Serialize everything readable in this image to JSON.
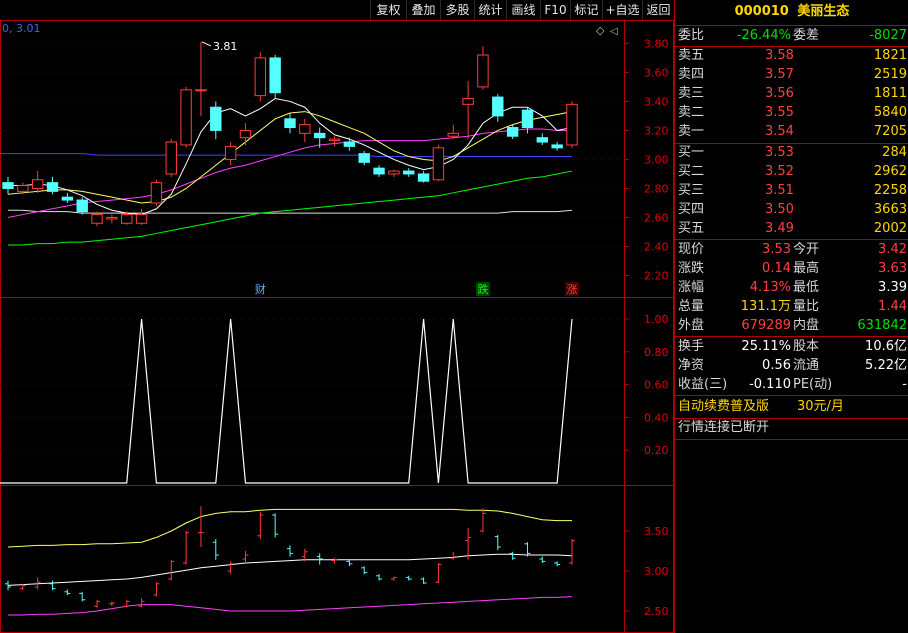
{
  "toolbar": {
    "buttons": [
      "复权",
      "叠加",
      "多股",
      "统计",
      "画线",
      "F10",
      "标记",
      "+自选",
      "返回"
    ]
  },
  "stock": {
    "code": "000010",
    "name": "美丽生态"
  },
  "chart": {
    "ma_legend": "0, 3.01",
    "high_label": "3.81",
    "price_axis": [
      "3.80",
      "3.60",
      "3.40",
      "3.20",
      "3.00",
      "2.80",
      "2.60",
      "2.40",
      "2.20"
    ],
    "markers": [
      "财",
      "跌",
      "涨"
    ],
    "ind_axis": [
      "1.00",
      "0.80",
      "0.60",
      "0.40",
      "0.20"
    ],
    "bot_axis": [
      "3.50",
      "3.00",
      "2.50"
    ],
    "colors": {
      "up": "#ff3c3c",
      "down": "#54ffff",
      "ma1": "#ffffff",
      "ma2": "#ffff66",
      "ma3": "#ff40ff",
      "ma4": "#00ff00",
      "ma5": "#4040ff",
      "frame": "#b00000"
    }
  },
  "chart_data": {
    "type": "candlestick",
    "candles": [
      {
        "o": 2.84,
        "h": 2.88,
        "l": 2.76,
        "c": 2.8
      },
      {
        "o": 2.78,
        "h": 2.84,
        "l": 2.76,
        "c": 2.82
      },
      {
        "o": 2.8,
        "h": 2.92,
        "l": 2.77,
        "c": 2.86
      },
      {
        "o": 2.84,
        "h": 2.88,
        "l": 2.76,
        "c": 2.78
      },
      {
        "o": 2.74,
        "h": 2.77,
        "l": 2.7,
        "c": 2.72
      },
      {
        "o": 2.72,
        "h": 2.74,
        "l": 2.62,
        "c": 2.64
      },
      {
        "o": 2.56,
        "h": 2.64,
        "l": 2.54,
        "c": 2.62
      },
      {
        "o": 2.59,
        "h": 2.62,
        "l": 2.56,
        "c": 2.6
      },
      {
        "o": 2.56,
        "h": 2.64,
        "l": 2.55,
        "c": 2.62
      },
      {
        "o": 2.56,
        "h": 2.66,
        "l": 2.55,
        "c": 2.62
      },
      {
        "o": 2.7,
        "h": 2.86,
        "l": 2.68,
        "c": 2.84
      },
      {
        "o": 2.9,
        "h": 3.14,
        "l": 2.88,
        "c": 3.12
      },
      {
        "o": 3.1,
        "h": 3.5,
        "l": 3.08,
        "c": 3.48
      },
      {
        "o": 3.48,
        "h": 3.81,
        "l": 3.3,
        "c": 3.48
      },
      {
        "o": 3.36,
        "h": 3.4,
        "l": 3.14,
        "c": 3.2
      },
      {
        "o": 3.0,
        "h": 3.12,
        "l": 2.96,
        "c": 3.09
      },
      {
        "o": 3.15,
        "h": 3.25,
        "l": 3.1,
        "c": 3.2
      },
      {
        "o": 3.44,
        "h": 3.74,
        "l": 3.4,
        "c": 3.7
      },
      {
        "o": 3.7,
        "h": 3.72,
        "l": 3.42,
        "c": 3.46
      },
      {
        "o": 3.28,
        "h": 3.32,
        "l": 3.18,
        "c": 3.22
      },
      {
        "o": 3.18,
        "h": 3.28,
        "l": 3.12,
        "c": 3.24
      },
      {
        "o": 3.18,
        "h": 3.22,
        "l": 3.08,
        "c": 3.15
      },
      {
        "o": 3.13,
        "h": 3.16,
        "l": 3.09,
        "c": 3.14
      },
      {
        "o": 3.12,
        "h": 3.15,
        "l": 3.06,
        "c": 3.09
      },
      {
        "o": 3.04,
        "h": 3.06,
        "l": 2.96,
        "c": 2.98
      },
      {
        "o": 2.94,
        "h": 2.96,
        "l": 2.88,
        "c": 2.9
      },
      {
        "o": 2.9,
        "h": 2.93,
        "l": 2.88,
        "c": 2.92
      },
      {
        "o": 2.92,
        "h": 2.94,
        "l": 2.88,
        "c": 2.9
      },
      {
        "o": 2.9,
        "h": 2.92,
        "l": 2.84,
        "c": 2.85
      },
      {
        "o": 2.86,
        "h": 3.1,
        "l": 2.85,
        "c": 3.08
      },
      {
        "o": 3.16,
        "h": 3.24,
        "l": 3.14,
        "c": 3.18
      },
      {
        "o": 3.38,
        "h": 3.54,
        "l": 3.14,
        "c": 3.42
      },
      {
        "o": 3.5,
        "h": 3.78,
        "l": 3.48,
        "c": 3.72
      },
      {
        "o": 3.43,
        "h": 3.45,
        "l": 3.26,
        "c": 3.3
      },
      {
        "o": 3.22,
        "h": 3.24,
        "l": 3.14,
        "c": 3.16
      },
      {
        "o": 3.34,
        "h": 3.36,
        "l": 3.18,
        "c": 3.22
      },
      {
        "o": 3.15,
        "h": 3.18,
        "l": 3.1,
        "c": 3.12
      },
      {
        "o": 3.1,
        "h": 3.12,
        "l": 3.06,
        "c": 3.08
      },
      {
        "o": 3.1,
        "h": 3.4,
        "l": 3.08,
        "c": 3.38
      }
    ],
    "ma1": [
      2.82,
      2.82,
      2.83,
      2.82,
      2.79,
      2.75,
      2.69,
      2.65,
      2.63,
      2.62,
      2.66,
      2.76,
      2.97,
      3.19,
      3.32,
      3.35,
      3.3,
      3.35,
      3.42,
      3.4,
      3.36,
      3.25,
      3.17,
      3.14,
      3.1,
      3.05,
      3.0,
      2.96,
      2.93,
      2.95,
      3.0,
      3.1,
      3.25,
      3.32,
      3.36,
      3.36,
      3.3,
      3.2,
      3.22
    ],
    "ma2": [
      2.76,
      2.77,
      2.78,
      2.79,
      2.79,
      2.78,
      2.76,
      2.74,
      2.72,
      2.7,
      2.71,
      2.74,
      2.8,
      2.88,
      2.96,
      3.04,
      3.12,
      3.2,
      3.28,
      3.32,
      3.33,
      3.3,
      3.26,
      3.22,
      3.18,
      3.12,
      3.06,
      3.02,
      3.0,
      2.99,
      3.02,
      3.08,
      3.14,
      3.2,
      3.24,
      3.27,
      3.29,
      3.31,
      3.33
    ],
    "ma3": [
      2.6,
      2.62,
      2.64,
      2.66,
      2.68,
      2.7,
      2.71,
      2.72,
      2.73,
      2.74,
      2.76,
      2.79,
      2.83,
      2.87,
      2.91,
      2.94,
      2.96,
      2.99,
      3.02,
      3.05,
      3.08,
      3.1,
      3.11,
      3.12,
      3.13,
      3.13,
      3.13,
      3.13,
      3.13,
      3.14,
      3.15,
      3.16,
      3.18,
      3.19,
      3.2,
      3.21,
      3.21,
      3.2,
      3.2
    ],
    "ma4": [
      2.41,
      2.41,
      2.42,
      2.42,
      2.43,
      2.43,
      2.44,
      2.45,
      2.46,
      2.47,
      2.49,
      2.51,
      2.53,
      2.55,
      2.57,
      2.59,
      2.61,
      2.63,
      2.64,
      2.65,
      2.66,
      2.67,
      2.68,
      2.69,
      2.7,
      2.71,
      2.72,
      2.73,
      2.74,
      2.75,
      2.77,
      2.79,
      2.81,
      2.83,
      2.85,
      2.87,
      2.88,
      2.9,
      2.92
    ],
    "ma4_len": 39,
    "blue_line": [
      3.04,
      3.04,
      3.04,
      3.04,
      3.04,
      3.04,
      3.04,
      3.03,
      3.03,
      3.03,
      3.03,
      3.03,
      3.03,
      3.03,
      3.03,
      3.03,
      3.03,
      3.03,
      3.03,
      3.03,
      3.03,
      3.03,
      3.03,
      3.03,
      3.03,
      3.03,
      3.03,
      3.02,
      3.02,
      3.02,
      3.02,
      3.02,
      3.02,
      3.02,
      3.02,
      3.02,
      3.02,
      3.02,
      3.02,
      3.02,
      3.02,
      3.02
    ],
    "white_flat": [
      2.65,
      2.65,
      2.64,
      2.64,
      2.64,
      2.63,
      2.63,
      2.63,
      2.63,
      2.63,
      2.63,
      2.63,
      2.63,
      2.63,
      2.63,
      2.63,
      2.63,
      2.63,
      2.63,
      2.63,
      2.63,
      2.63,
      2.63,
      2.63,
      2.63,
      2.63,
      2.63,
      2.63,
      2.63,
      2.63,
      2.63,
      2.63,
      2.63,
      2.63,
      2.64,
      2.64,
      2.64,
      2.64,
      2.65
    ],
    "indicator": [
      0,
      0,
      0,
      0,
      0,
      0,
      0,
      0,
      0,
      1,
      0,
      0,
      0,
      0,
      0,
      1,
      0,
      0,
      0,
      0,
      0,
      0,
      0,
      0,
      0,
      0,
      0,
      0,
      1,
      0,
      1,
      0,
      0,
      0,
      0,
      0,
      0,
      0,
      1
    ],
    "indicator_range": [
      0,
      1
    ],
    "price_range": [
      2.1,
      3.92
    ],
    "bot_range": [
      2.25,
      4.05
    ],
    "bot_upper": [
      3.3,
      3.31,
      3.32,
      3.32,
      3.33,
      3.33,
      3.34,
      3.34,
      3.35,
      3.36,
      3.42,
      3.5,
      3.6,
      3.68,
      3.72,
      3.74,
      3.74,
      3.76,
      3.77,
      3.77,
      3.77,
      3.77,
      3.77,
      3.77,
      3.77,
      3.77,
      3.77,
      3.77,
      3.77,
      3.77,
      3.77,
      3.76,
      3.76,
      3.75,
      3.72,
      3.68,
      3.64,
      3.63,
      3.63
    ],
    "bot_mid": [
      2.82,
      2.83,
      2.84,
      2.85,
      2.86,
      2.87,
      2.88,
      2.89,
      2.9,
      2.92,
      2.95,
      2.98,
      3.01,
      3.04,
      3.06,
      3.08,
      3.1,
      3.11,
      3.12,
      3.13,
      3.14,
      3.14,
      3.14,
      3.14,
      3.14,
      3.14,
      3.14,
      3.14,
      3.15,
      3.16,
      3.17,
      3.19,
      3.2,
      3.21,
      3.21,
      3.2,
      3.2,
      3.2,
      3.19
    ],
    "bot_lower": [
      2.45,
      2.45,
      2.46,
      2.46,
      2.47,
      2.48,
      2.5,
      2.53,
      2.56,
      2.58,
      2.58,
      2.58,
      2.56,
      2.54,
      2.52,
      2.5,
      2.5,
      2.5,
      2.5,
      2.5,
      2.51,
      2.52,
      2.53,
      2.54,
      2.55,
      2.56,
      2.57,
      2.58,
      2.59,
      2.6,
      2.61,
      2.62,
      2.63,
      2.64,
      2.65,
      2.66,
      2.67,
      2.67,
      2.68
    ]
  },
  "quote": {
    "weibi": {
      "label": "委比",
      "value": "-26.44%"
    },
    "weicha": {
      "label": "委差",
      "value": "-8027"
    },
    "sell": [
      {
        "label": "卖五",
        "price": "3.58",
        "vol": "1821"
      },
      {
        "label": "卖四",
        "price": "3.57",
        "vol": "2519"
      },
      {
        "label": "卖三",
        "price": "3.56",
        "vol": "1811"
      },
      {
        "label": "卖二",
        "price": "3.55",
        "vol": "5840"
      },
      {
        "label": "卖一",
        "price": "3.54",
        "vol": "7205"
      }
    ],
    "buy": [
      {
        "label": "买一",
        "price": "3.53",
        "vol": "284"
      },
      {
        "label": "买二",
        "price": "3.52",
        "vol": "2962"
      },
      {
        "label": "买三",
        "price": "3.51",
        "vol": "2258"
      },
      {
        "label": "买四",
        "price": "3.50",
        "vol": "3663"
      },
      {
        "label": "买五",
        "price": "3.49",
        "vol": "2002"
      }
    ],
    "stats": [
      {
        "l1": "现价",
        "v1": "3.53",
        "c1": "red",
        "l2": "今开",
        "v2": "3.42",
        "c2": "red"
      },
      {
        "l1": "涨跌",
        "v1": "0.14",
        "c1": "red",
        "l2": "最高",
        "v2": "3.63",
        "c2": "red"
      },
      {
        "l1": "涨幅",
        "v1": "4.13%",
        "c1": "red",
        "l2": "最低",
        "v2": "3.39",
        "c2": "wht"
      },
      {
        "l1": "总量",
        "v1": "131.1万",
        "c1": "yel",
        "l2": "量比",
        "v2": "1.44",
        "c2": "red"
      },
      {
        "l1": "外盘",
        "v1": "679289",
        "c1": "red",
        "l2": "内盘",
        "v2": "631842",
        "c2": "grn"
      }
    ],
    "stats2": [
      {
        "l1": "换手",
        "v1": "25.11%",
        "c1": "wht",
        "l2": "股本",
        "v2": "10.6亿",
        "c2": "wht"
      },
      {
        "l1": "净资",
        "v1": "0.56",
        "c1": "wht",
        "l2": "流通",
        "v2": "5.22亿",
        "c2": "wht"
      },
      {
        "l1": "收益(三)",
        "v1": "-0.110",
        "c1": "wht",
        "l2": "PE(动)",
        "v2": "-",
        "c2": "wht"
      }
    ],
    "promo": {
      "text": "自动续费普及版",
      "price": "30元/月"
    },
    "status": "行情连接已断开"
  }
}
